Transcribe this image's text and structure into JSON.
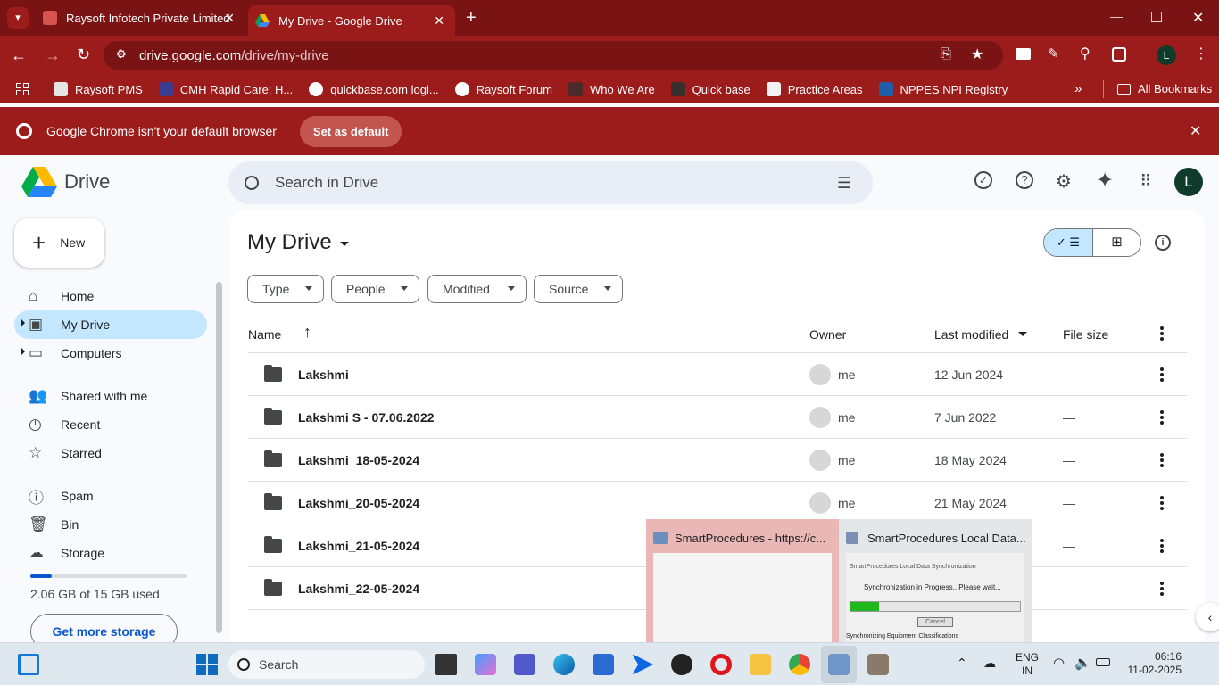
{
  "browser": {
    "tabs": [
      {
        "title": "Raysoft Infotech Private Limited"
      },
      {
        "title": "My Drive - Google Drive"
      }
    ],
    "url_host": "drive.google.com",
    "url_path": "/drive/my-drive",
    "profile_initial": "L",
    "bookmarks": [
      "Raysoft PMS",
      "CMH Rapid Care: H...",
      "quickbase.com logi...",
      "Raysoft Forum",
      "Who We Are",
      "Quick base",
      "Practice Areas",
      "NPPES NPI Registry"
    ],
    "all_bookmarks": "All Bookmarks",
    "infobar_text": "Google Chrome isn't your default browser",
    "set_default": "Set as default"
  },
  "drive": {
    "logo_text": "Drive",
    "search_placeholder": "Search in Drive",
    "new_label": "New",
    "avatar": "L",
    "nav": [
      {
        "label": "Home"
      },
      {
        "label": "My Drive",
        "active": true
      },
      {
        "label": "Computers"
      },
      {
        "label": "Shared with me"
      },
      {
        "label": "Recent"
      },
      {
        "label": "Starred"
      },
      {
        "label": "Spam"
      },
      {
        "label": "Bin"
      },
      {
        "label": "Storage"
      }
    ],
    "storage_text": "2.06 GB of 15 GB used",
    "storage_fraction": 0.137,
    "get_storage": "Get more storage",
    "title": "My Drive",
    "filters": [
      "Type",
      "People",
      "Modified",
      "Source"
    ],
    "columns": {
      "name": "Name",
      "owner": "Owner",
      "modified": "Last modified",
      "size": "File size"
    },
    "rows": [
      {
        "name": "Lakshmi",
        "owner": "me",
        "modified": "12 Jun 2024",
        "size": "—"
      },
      {
        "name": "Lakshmi S - 07.06.2022",
        "owner": "me",
        "modified": "7 Jun 2022",
        "size": "—"
      },
      {
        "name": "Lakshmi_18-05-2024",
        "owner": "me",
        "modified": "18 May 2024",
        "size": "—"
      },
      {
        "name": "Lakshmi_20-05-2024",
        "owner": "me",
        "modified": "21 May 2024",
        "size": "—"
      },
      {
        "name": "Lakshmi_21-05-2024",
        "owner": "",
        "modified": "",
        "size": "—"
      },
      {
        "name": "Lakshmi_22-05-2024",
        "owner": "",
        "modified": "",
        "size": "—"
      }
    ]
  },
  "previews": [
    {
      "title": "SmartProcedures - https://c..."
    },
    {
      "title": "SmartProcedures Local Data...",
      "body_title": "SmartProcedures Local Data Synchronization",
      "status": "Synchronization in Progress.. Please wait...",
      "cancel": "Cancel",
      "footer": "Synchronizing Equipment Classifications",
      "progress_fraction": 0.17
    }
  ],
  "taskbar": {
    "search_label": "Search",
    "lang": "ENG",
    "region": "IN",
    "time": "06:16",
    "date": "11-02-2025"
  },
  "colors": {
    "accent": "#0b57d0",
    "active_nav": "#c2e7ff",
    "chrome_frame": "#9c1b1b",
    "chrome_tabstrip": "#7a1313"
  }
}
